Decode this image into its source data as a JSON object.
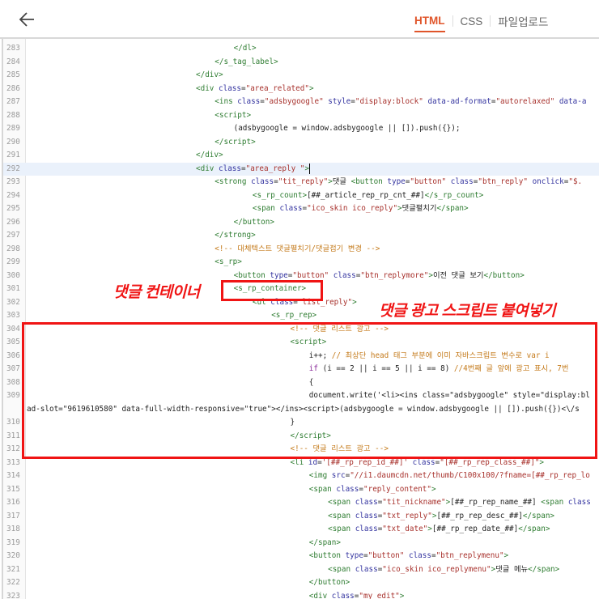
{
  "header": {
    "back_icon": "arrow-left-icon",
    "tabs": [
      {
        "label": "HTML",
        "active": true
      },
      {
        "label": "CSS",
        "active": false
      },
      {
        "label": "파일업로드",
        "active": false
      }
    ],
    "accent_color": "#e0552a"
  },
  "annotations": {
    "container_label": "댓글 컨테이너",
    "script_label": "댓글 광고 스크립트 붙여넣기",
    "color": "#f01414"
  },
  "code": {
    "highlighted_line": 292,
    "lines": [
      {
        "n": "283",
        "indent": 2,
        "tokens": [
          [
            "t",
            "</dl>"
          ]
        ]
      },
      {
        "n": "284",
        "indent": 1,
        "tokens": [
          [
            "t",
            "</s_tag_label>"
          ]
        ]
      },
      {
        "n": "285",
        "indent": 0,
        "tokens": [
          [
            "t",
            "</div>"
          ]
        ]
      },
      {
        "n": "286",
        "indent": 0,
        "tokens": [
          [
            "t",
            "<div "
          ],
          [
            "a",
            "class"
          ],
          [
            "x",
            "="
          ],
          [
            "v",
            "\"area_related\""
          ],
          [
            "t",
            ">"
          ]
        ]
      },
      {
        "n": "287",
        "indent": 1,
        "tokens": [
          [
            "t",
            "<ins "
          ],
          [
            "a",
            "class"
          ],
          [
            "x",
            "="
          ],
          [
            "v",
            "\"adsbygoogle\""
          ],
          [
            "x",
            " "
          ],
          [
            "a",
            "style"
          ],
          [
            "x",
            "="
          ],
          [
            "v",
            "\"display:block\""
          ],
          [
            "x",
            " "
          ],
          [
            "a",
            "data-ad-format"
          ],
          [
            "x",
            "="
          ],
          [
            "v",
            "\"autorelaxed\""
          ],
          [
            "x",
            " "
          ],
          [
            "a",
            "data-a"
          ]
        ]
      },
      {
        "n": "288",
        "indent": 1,
        "tokens": [
          [
            "t",
            "<script>"
          ]
        ]
      },
      {
        "n": "289",
        "indent": 2,
        "tokens": [
          [
            "x",
            "(adsbygoogle = window.adsbygoogle || []).push({});"
          ]
        ]
      },
      {
        "n": "290",
        "indent": 1,
        "tokens": [
          [
            "t",
            "</script>"
          ]
        ]
      },
      {
        "n": "291",
        "indent": 0,
        "tokens": [
          [
            "t",
            "</div>"
          ]
        ]
      },
      {
        "n": "292",
        "indent": 0,
        "tokens": [
          [
            "t",
            "<div "
          ],
          [
            "a",
            "class"
          ],
          [
            "x",
            "="
          ],
          [
            "v",
            "\"area_reply \""
          ],
          [
            "t",
            ">"
          ]
        ]
      },
      {
        "n": "293",
        "indent": 1,
        "tokens": [
          [
            "t",
            "<strong "
          ],
          [
            "a",
            "class"
          ],
          [
            "x",
            "="
          ],
          [
            "v",
            "\"tit_reply\""
          ],
          [
            "t",
            ">"
          ],
          [
            "x",
            "댓글 "
          ],
          [
            "t",
            "<button "
          ],
          [
            "a",
            "type"
          ],
          [
            "x",
            "="
          ],
          [
            "v",
            "\"button\""
          ],
          [
            "x",
            " "
          ],
          [
            "a",
            "class"
          ],
          [
            "x",
            "="
          ],
          [
            "v",
            "\"btn_reply\""
          ],
          [
            "x",
            " "
          ],
          [
            "a",
            "onclick"
          ],
          [
            "x",
            "="
          ],
          [
            "v",
            "\"$."
          ]
        ]
      },
      {
        "n": "294",
        "indent": 3,
        "tokens": [
          [
            "t",
            "<s_rp_count>"
          ],
          [
            "x",
            "[##_article_rep_rp_cnt_##]"
          ],
          [
            "t",
            "</s_rp_count>"
          ]
        ]
      },
      {
        "n": "295",
        "indent": 3,
        "tokens": [
          [
            "t",
            "<span "
          ],
          [
            "a",
            "class"
          ],
          [
            "x",
            "="
          ],
          [
            "v",
            "\"ico_skin ico_reply\""
          ],
          [
            "t",
            ">"
          ],
          [
            "x",
            "댓글펼치기"
          ],
          [
            "t",
            "</span>"
          ]
        ]
      },
      {
        "n": "296",
        "indent": 2,
        "tokens": [
          [
            "t",
            "</button>"
          ]
        ]
      },
      {
        "n": "297",
        "indent": 1,
        "tokens": [
          [
            "t",
            "</strong>"
          ]
        ]
      },
      {
        "n": "298",
        "indent": 1,
        "tokens": [
          [
            "c",
            "<!-- 대체텍스트 댓글펼치기/댓글접기 변경 -->"
          ]
        ]
      },
      {
        "n": "299",
        "indent": 1,
        "tokens": [
          [
            "t",
            "<s_rp>"
          ]
        ]
      },
      {
        "n": "300",
        "indent": 2,
        "tokens": [
          [
            "t",
            "<button "
          ],
          [
            "a",
            "type"
          ],
          [
            "x",
            "="
          ],
          [
            "v",
            "\"button\""
          ],
          [
            "x",
            " "
          ],
          [
            "a",
            "class"
          ],
          [
            "x",
            "="
          ],
          [
            "v",
            "\"btn_replymore\""
          ],
          [
            "t",
            ">"
          ],
          [
            "x",
            "이전 댓글 보기"
          ],
          [
            "t",
            "</button>"
          ]
        ]
      },
      {
        "n": "301",
        "indent": 2,
        "tokens": [
          [
            "t",
            "<s_rp_container>"
          ]
        ]
      },
      {
        "n": "302",
        "indent": 3,
        "tokens": [
          [
            "t",
            "<ul "
          ],
          [
            "a",
            "class"
          ],
          [
            "x",
            "="
          ],
          [
            "v",
            "\"list_reply\""
          ],
          [
            "t",
            ">"
          ]
        ]
      },
      {
        "n": "303",
        "indent": 4,
        "tokens": [
          [
            "t",
            "<s_rp_rep>"
          ]
        ]
      },
      {
        "n": "304",
        "indent": 5,
        "tokens": [
          [
            "c",
            "<!-- 댓글 리스트 광고 -->"
          ]
        ]
      },
      {
        "n": "305",
        "indent": 5,
        "tokens": [
          [
            "t",
            "<script>"
          ]
        ]
      },
      {
        "n": "306",
        "indent": 6,
        "tokens": [
          [
            "x",
            "i++; "
          ],
          [
            "c",
            "// 최상단 head 태그 부분에 이미 자바스크립트 변수로 var i"
          ]
        ]
      },
      {
        "n": "307",
        "indent": 6,
        "tokens": [
          [
            "k",
            "if"
          ],
          [
            "x",
            " (i == 2 || i == 5 || i == 8) "
          ],
          [
            "c",
            "//4번째 글 앞에 광고 표시, 7번"
          ]
        ]
      },
      {
        "n": "308",
        "indent": 6,
        "tokens": [
          [
            "x",
            "{"
          ]
        ]
      },
      {
        "n": "309",
        "indent": 6,
        "tokens": [
          [
            "x",
            "document.write('<li><ins class=\"adsbygoogle\" style=\"display:bl"
          ]
        ]
      },
      {
        "n": "",
        "indent": -1,
        "tokens": [
          [
            "x",
            "ad-slot=\"9619610580\" data-full-width-responsive=\"true\"></ins><script>(adsbygoogle = window.adsbygoogle || []).push({})<\\/s"
          ]
        ]
      },
      {
        "n": "310",
        "indent": 5,
        "tokens": [
          [
            "x",
            "}"
          ]
        ]
      },
      {
        "n": "311",
        "indent": 5,
        "tokens": [
          [
            "t",
            "</script>"
          ]
        ]
      },
      {
        "n": "312",
        "indent": 5,
        "tokens": [
          [
            "c",
            "<!-- 댓글 리스트 광고 -->"
          ]
        ]
      },
      {
        "n": "313",
        "indent": 5,
        "tokens": [
          [
            "t",
            "<li "
          ],
          [
            "a",
            "id"
          ],
          [
            "x",
            "="
          ],
          [
            "v",
            "'[##_rp_rep_id_##]'"
          ],
          [
            "x",
            " "
          ],
          [
            "a",
            "class"
          ],
          [
            "x",
            "="
          ],
          [
            "v",
            "\"[##_rp_rep_class_##]\""
          ],
          [
            "t",
            ">"
          ]
        ]
      },
      {
        "n": "314",
        "indent": 6,
        "tokens": [
          [
            "t",
            "<img "
          ],
          [
            "a",
            "src"
          ],
          [
            "x",
            "="
          ],
          [
            "v",
            "\"//i1.daumcdn.net/thumb/C100x100/?fname=[##_rp_rep_lo"
          ]
        ]
      },
      {
        "n": "315",
        "indent": 6,
        "tokens": [
          [
            "t",
            "<span "
          ],
          [
            "a",
            "class"
          ],
          [
            "x",
            "="
          ],
          [
            "v",
            "\"reply_content\""
          ],
          [
            "t",
            ">"
          ]
        ]
      },
      {
        "n": "316",
        "indent": 7,
        "tokens": [
          [
            "t",
            "<span "
          ],
          [
            "a",
            "class"
          ],
          [
            "x",
            "="
          ],
          [
            "v",
            "\"tit_nickname\""
          ],
          [
            "t",
            ">"
          ],
          [
            "x",
            "[##_rp_rep_name_##] "
          ],
          [
            "t",
            "<span "
          ],
          [
            "a",
            "class"
          ]
        ]
      },
      {
        "n": "317",
        "indent": 7,
        "tokens": [
          [
            "t",
            "<span "
          ],
          [
            "a",
            "class"
          ],
          [
            "x",
            "="
          ],
          [
            "v",
            "\"txt_reply\""
          ],
          [
            "t",
            ">"
          ],
          [
            "x",
            "[##_rp_rep_desc_##]"
          ],
          [
            "t",
            "</span>"
          ]
        ]
      },
      {
        "n": "318",
        "indent": 7,
        "tokens": [
          [
            "t",
            "<span "
          ],
          [
            "a",
            "class"
          ],
          [
            "x",
            "="
          ],
          [
            "v",
            "\"txt_date\""
          ],
          [
            "t",
            ">"
          ],
          [
            "x",
            "[##_rp_rep_date_##]"
          ],
          [
            "t",
            "</span>"
          ]
        ]
      },
      {
        "n": "319",
        "indent": 6,
        "tokens": [
          [
            "t",
            "</span>"
          ]
        ]
      },
      {
        "n": "320",
        "indent": 6,
        "tokens": [
          [
            "t",
            "<button "
          ],
          [
            "a",
            "type"
          ],
          [
            "x",
            "="
          ],
          [
            "v",
            "\"button\""
          ],
          [
            "x",
            " "
          ],
          [
            "a",
            "class"
          ],
          [
            "x",
            "="
          ],
          [
            "v",
            "\"btn_replymenu\""
          ],
          [
            "t",
            ">"
          ]
        ]
      },
      {
        "n": "321",
        "indent": 7,
        "tokens": [
          [
            "t",
            "<span "
          ],
          [
            "a",
            "class"
          ],
          [
            "x",
            "="
          ],
          [
            "v",
            "\"ico_skin ico_replymenu\""
          ],
          [
            "t",
            ">"
          ],
          [
            "x",
            "댓글 메뉴"
          ],
          [
            "t",
            "</span>"
          ]
        ]
      },
      {
        "n": "322",
        "indent": 6,
        "tokens": [
          [
            "t",
            "</button>"
          ]
        ]
      },
      {
        "n": "323",
        "indent": 6,
        "tokens": [
          [
            "t",
            "<div "
          ],
          [
            "a",
            "class"
          ],
          [
            "x",
            "="
          ],
          [
            "v",
            "\"my_edit\""
          ],
          [
            "t",
            ">"
          ]
        ]
      }
    ]
  }
}
